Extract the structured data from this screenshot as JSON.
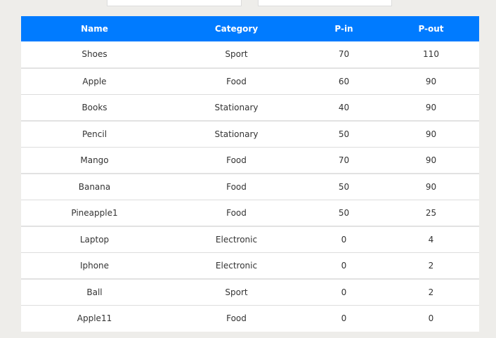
{
  "table": {
    "columns": [
      "Name",
      "Category",
      "P-in",
      "P-out"
    ],
    "rows": [
      [
        "Shoes",
        "Sport",
        "70",
        "110"
      ],
      [
        "Apple",
        "Food",
        "60",
        "90"
      ],
      [
        "Books",
        "Stationary",
        "40",
        "90"
      ],
      [
        "Pencil",
        "Stationary",
        "50",
        "90"
      ],
      [
        "Mango",
        "Food",
        "70",
        "90"
      ],
      [
        "Banana",
        "Food",
        "50",
        "90"
      ],
      [
        "Pineapple1",
        "Food",
        "50",
        "25"
      ],
      [
        "Laptop",
        "Electronic",
        "0",
        "4"
      ],
      [
        "Iphone",
        "Electronic",
        "0",
        "2"
      ],
      [
        "Ball",
        "Sport",
        "0",
        "2"
      ],
      [
        "Apple11",
        "Food",
        "0",
        "0"
      ]
    ]
  },
  "colors": {
    "header_bg": "#007bff",
    "page_bg": "#eeedea"
  }
}
